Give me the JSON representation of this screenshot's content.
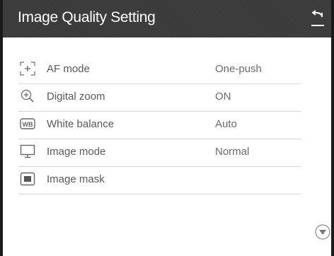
{
  "header": {
    "title": "Image Quality Setting",
    "back_icon": "return-arrow-icon"
  },
  "settings": [
    {
      "icon": "af-frame-icon",
      "label": "AF mode",
      "value": "One-push"
    },
    {
      "icon": "zoom-in-icon",
      "label": "Digital zoom",
      "value": "ON"
    },
    {
      "icon": "wb-icon",
      "label": "White balance",
      "value": "Auto"
    },
    {
      "icon": "monitor-icon",
      "label": "Image mode",
      "value": "Normal"
    },
    {
      "icon": "mask-icon",
      "label": "Image mask",
      "value": ""
    }
  ],
  "scroll": {
    "icon": "scroll-down-icon"
  },
  "colors": {
    "header_bg": "#3a3a3a",
    "text": "#595959",
    "divider": "#d6d6d6"
  }
}
